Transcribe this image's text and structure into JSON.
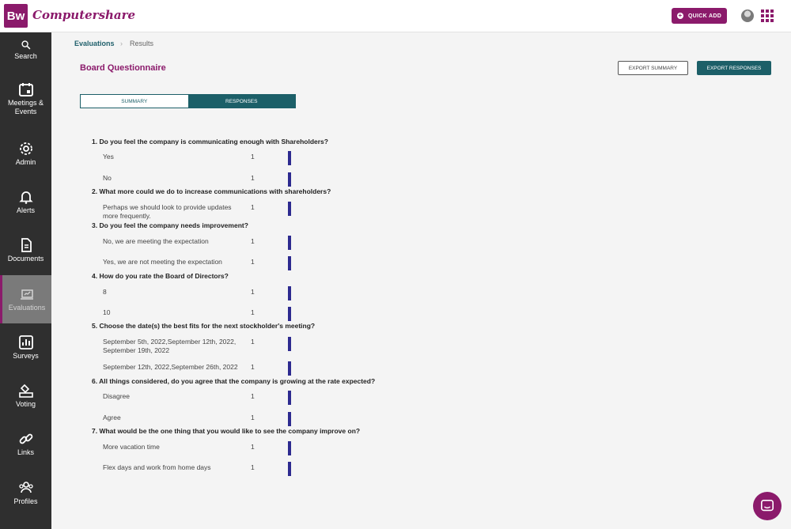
{
  "header": {
    "logo_text": "Bw",
    "brand": "Computershare",
    "quick_add_label": "QUICK ADD"
  },
  "sidebar": {
    "items": [
      {
        "label": "Search",
        "icon": "search-icon"
      },
      {
        "label": "Meetings & Events",
        "icon": "calendar-icon"
      },
      {
        "label": "Admin",
        "icon": "gear-icon"
      },
      {
        "label": "Alerts",
        "icon": "bell-icon"
      },
      {
        "label": "Documents",
        "icon": "document-icon"
      },
      {
        "label": "Evaluations",
        "icon": "evaluation-icon",
        "active": true
      },
      {
        "label": "Surveys",
        "icon": "chart-icon"
      },
      {
        "label": "Voting",
        "icon": "ballot-icon"
      },
      {
        "label": "Links",
        "icon": "link-icon"
      },
      {
        "label": "Profiles",
        "icon": "users-icon"
      }
    ]
  },
  "breadcrumb": {
    "parent": "Evaluations",
    "separator": "›",
    "current": "Results"
  },
  "page": {
    "title": "Board Questionnaire",
    "export_summary_label": "EXPORT SUMMARY",
    "export_responses_label": "EXPORT RESPONSES"
  },
  "tabs": [
    {
      "label": "SUMMARY",
      "active": false
    },
    {
      "label": "RESPONSES",
      "active": true
    }
  ],
  "questions": [
    {
      "text": "1. Do you feel the company is communicating enough with Shareholders?",
      "answers": [
        {
          "text": "Yes",
          "count": "1"
        },
        {
          "text": "No",
          "count": "1"
        }
      ]
    },
    {
      "text": "2. What more could we do to increase communications with shareholders?",
      "answers": [
        {
          "text": "Perhaps we should look to provide updates more frequently.",
          "count": "1"
        }
      ]
    },
    {
      "text": "3. Do you feel the company needs improvement?",
      "answers": [
        {
          "text": "No, we are meeting the expectation",
          "count": "1"
        },
        {
          "text": "Yes, we are not meeting the expectation",
          "count": "1"
        }
      ]
    },
    {
      "text": "4. How do you rate the Board of Directors?",
      "answers": [
        {
          "text": "8",
          "count": "1"
        },
        {
          "text": "10",
          "count": "1"
        }
      ]
    },
    {
      "text": "5. Choose the date(s) the best fits for the next stockholder's meeting?",
      "answers": [
        {
          "text": "September 5th, 2022,September 12th, 2022, September 19th, 2022",
          "count": "1"
        },
        {
          "text": "September 12th, 2022,September 26th, 2022",
          "count": "1"
        }
      ]
    },
    {
      "text": "6. All things considered, do you agree that the company is growing at the rate expected?",
      "answers": [
        {
          "text": "Disagree",
          "count": "1"
        },
        {
          "text": "Agree",
          "count": "1"
        }
      ]
    },
    {
      "text": "7. What would be the one thing that you would like to see the company improve on?",
      "answers": [
        {
          "text": "More vacation time",
          "count": "1"
        },
        {
          "text": "Flex days and work from home days",
          "count": "1"
        }
      ]
    }
  ],
  "colors": {
    "brand": "#8b1a6b",
    "teal": "#1c5f68",
    "bar": "#2d2a8f",
    "sidebar": "#2f2f2f"
  }
}
